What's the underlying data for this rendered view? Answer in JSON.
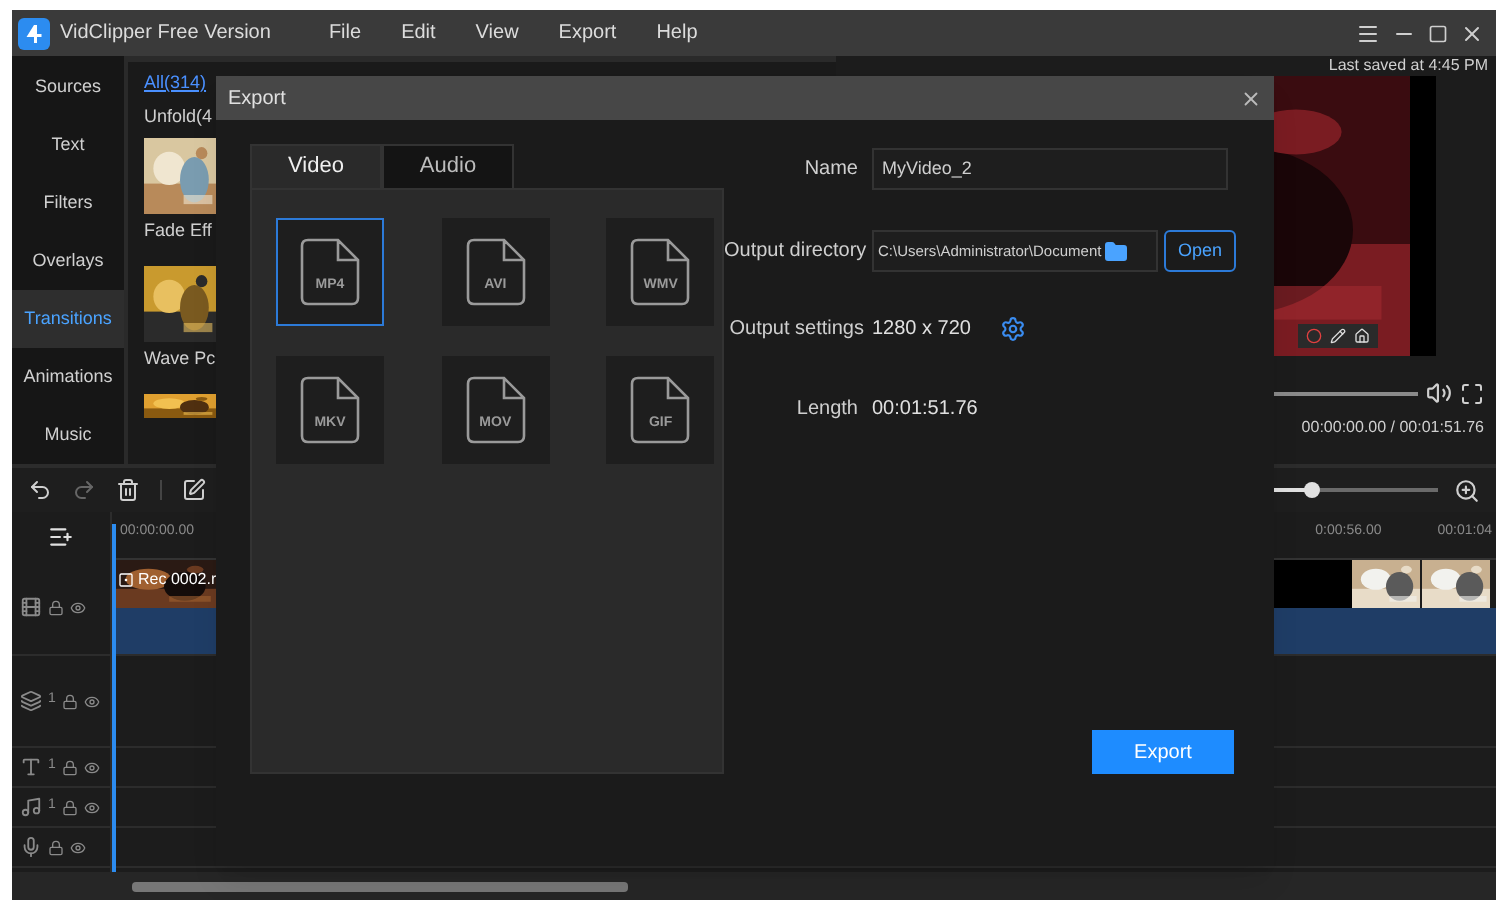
{
  "app": {
    "title": "VidClipper Free Version",
    "menu": [
      "File",
      "Edit",
      "View",
      "Export",
      "Help"
    ]
  },
  "sidebar": {
    "items": [
      {
        "label": "Sources",
        "selected": false
      },
      {
        "label": "Text",
        "selected": false
      },
      {
        "label": "Filters",
        "selected": false
      },
      {
        "label": "Overlays",
        "selected": false
      },
      {
        "label": "Transitions",
        "selected": true
      },
      {
        "label": "Animations",
        "selected": false
      },
      {
        "label": "Music",
        "selected": false
      }
    ]
  },
  "library": {
    "filter_all": "All(314)",
    "unfold": "Unfold(4",
    "items": [
      {
        "label": "Fade Eff"
      },
      {
        "label": "Wave Pc"
      }
    ]
  },
  "preview": {
    "saved": "Last saved at 4:45 PM",
    "time": "00:00:00.00 / 00:01:51.76"
  },
  "timeline": {
    "zoom": {
      "level": 0.3
    },
    "ruler": [
      "00:00:00.00",
      "0:00:56.00",
      "00:01:04"
    ],
    "clip": "Rec 0002.r",
    "tracks": [
      {
        "kind": "video"
      },
      {
        "kind": "overlay",
        "number": "1"
      },
      {
        "kind": "text",
        "number": "1"
      },
      {
        "kind": "music",
        "number": "1"
      },
      {
        "kind": "voice"
      }
    ]
  },
  "dialog": {
    "title": "Export",
    "tabs": [
      {
        "label": "Video",
        "selected": true
      },
      {
        "label": "Audio",
        "selected": false
      }
    ],
    "formats": [
      {
        "label": "MP4",
        "selected": true
      },
      {
        "label": "AVI",
        "selected": false
      },
      {
        "label": "WMV",
        "selected": false
      },
      {
        "label": "MKV",
        "selected": false
      },
      {
        "label": "MOV",
        "selected": false
      },
      {
        "label": "GIF",
        "selected": false
      }
    ],
    "name_label": "Name",
    "name": "MyVideo_2",
    "dir_label": "Output directory",
    "dir": "C:\\Users\\Administrator\\Document",
    "open": "Open",
    "settings_label": "Output settings",
    "settings": "1280 x 720",
    "length_label": "Length",
    "length": "00:01:51.76",
    "export": "Export"
  }
}
